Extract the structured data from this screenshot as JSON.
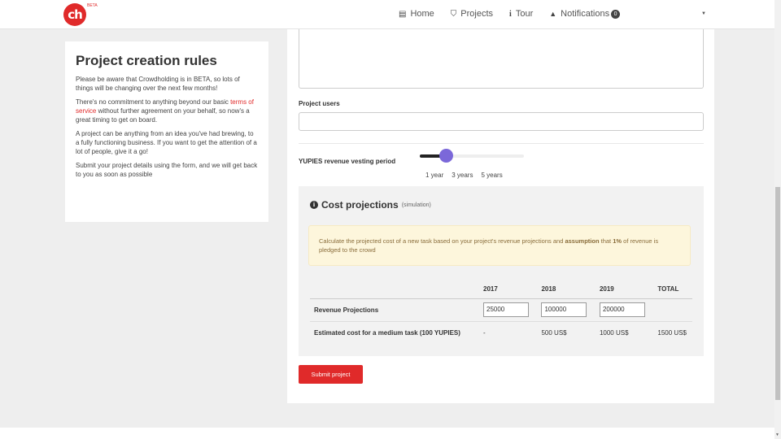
{
  "nav": {
    "logo_text": "ch",
    "beta": "BETA",
    "links": [
      {
        "icon": "home-icon",
        "glyph": "▤",
        "label": "Home"
      },
      {
        "icon": "projects-icon",
        "glyph": "⛉",
        "label": "Projects"
      },
      {
        "icon": "tour-icon",
        "glyph": "i",
        "label": "Tour"
      },
      {
        "icon": "bell-icon",
        "glyph": "🔔",
        "label": "Notifications"
      }
    ],
    "notifications_count": "0"
  },
  "rules": {
    "title": "Project creation rules",
    "p1": "Please be aware that Crowdholding is in BETA, so lots of things will be changing over the next few months!",
    "p2_before": "There's no commitment to anything beyond our basic ",
    "p2_link": "terms of service",
    "p2_after": " without further agreement on your behalf, so now's a great timing to get on board.",
    "p3": "A project can be anything from an idea you've had brewing, to a fully functioning business. If you want to get the attention of a lot of people, give it a go!",
    "p4": "Submit your project details using the form, and we will get back to you as soon as possible"
  },
  "form": {
    "users_label": "Project users",
    "users_value": "",
    "vesting_label": "YUPIES revenue vesting period",
    "vesting_options": [
      "1 year",
      "3 years",
      "5 years"
    ],
    "vesting_selected_index": 0,
    "vesting_fraction": 0.25
  },
  "cost": {
    "title": "Cost projections",
    "subtitle": "(simulation)",
    "alert_part1": "Calculate the projected cost of a new task based on your project's revenue projections and ",
    "alert_bold1": "assumption",
    "alert_part2": " that ",
    "alert_bold2": "1%",
    "alert_part3": " of revenue is pledged to the crowd",
    "columns": [
      "",
      "2017",
      "2018",
      "2019",
      "TOTAL"
    ],
    "revenue_label": "Revenue Projections",
    "revenue_values": [
      "25000",
      "100000",
      "200000"
    ],
    "cost_label": "Estimated cost for a medium task (100 YUPIES)",
    "cost_values": [
      "-",
      "500 US$",
      "1000 US$",
      "1500 US$"
    ]
  },
  "submit_label": "Submit project",
  "colors": {
    "brand": "#e02a2a",
    "slider": "#7b68d9",
    "alert_bg": "#fdf6dc"
  }
}
